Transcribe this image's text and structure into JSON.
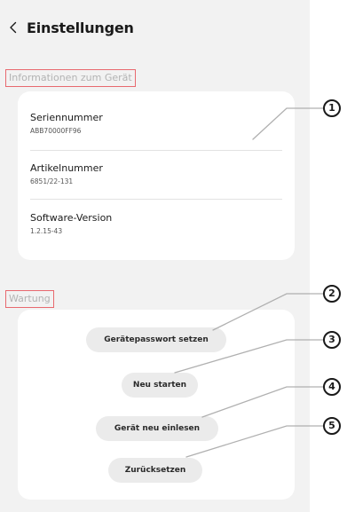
{
  "header": {
    "title": "Einstellungen"
  },
  "device_info": {
    "section_title": "Informationen zum Gerät",
    "items": [
      {
        "label": "Seriennummer",
        "value": "ABB70000FF96"
      },
      {
        "label": "Artikelnummer",
        "value": "6851/22-131"
      },
      {
        "label": "Software-Version",
        "value": "1.2.15-43"
      }
    ]
  },
  "maintenance": {
    "section_title": "Wartung",
    "buttons": [
      {
        "label": "Gerätepasswort setzen"
      },
      {
        "label": "Neu starten"
      },
      {
        "label": "Gerät neu einlesen"
      },
      {
        "label": "Zurücksetzen"
      }
    ]
  },
  "callouts": [
    "1",
    "2",
    "3",
    "4",
    "5"
  ],
  "colors": {
    "panel_background": "#f2f2f2",
    "card_background": "#ffffff",
    "button_background": "#ebebeb",
    "highlight_border": "#e8696f",
    "section_title_text": "#b3b3b3"
  },
  "icons": {
    "back": "chevron-left-icon"
  }
}
